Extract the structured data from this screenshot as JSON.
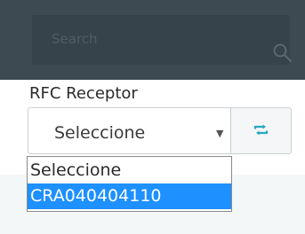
{
  "search": {
    "placeholder": "Search",
    "icon": "search-icon"
  },
  "rfc_receptor": {
    "label": "RFC Receptor",
    "selected_value": "Seleccione",
    "options": [
      {
        "label": "Seleccione",
        "highlighted": false
      },
      {
        "label": "CRA040404110",
        "highlighted": true
      }
    ],
    "refresh_icon": "refresh-icon"
  },
  "colors": {
    "topbar": "#3d4a51",
    "highlight": "#1e90ff",
    "refresh_icon": "#29a9c0"
  }
}
